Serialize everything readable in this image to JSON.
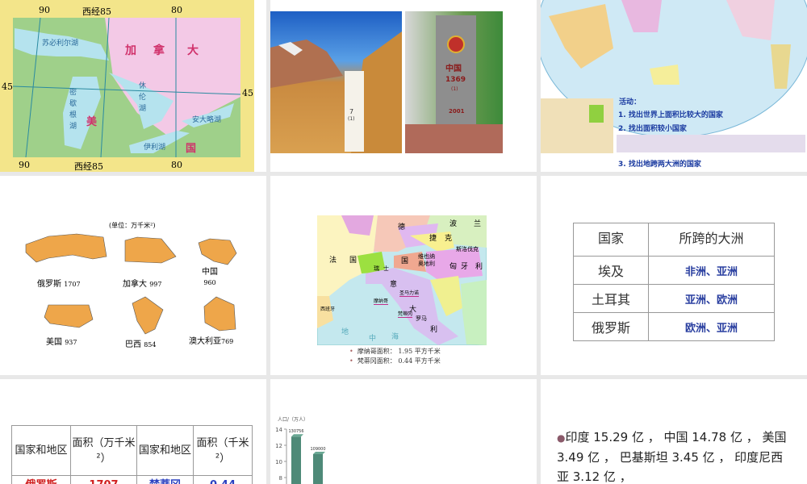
{
  "slides": [
    {
      "id": 1,
      "lon_labels": [
        "90",
        "西经85",
        "80"
      ],
      "lat_label": "45",
      "lakes": [
        "苏必利尔湖",
        "密歇根湖",
        "休伦湖",
        "伊利湖",
        "安大略湖"
      ],
      "countries": [
        "加",
        "拿",
        "大",
        "美",
        "国"
      ]
    },
    {
      "id": 2,
      "marker_left": {
        "number": "7",
        "sub": "(1)"
      },
      "marker_right": {
        "country": "中国",
        "number": "1369",
        "sub": "(1)",
        "year": "2001"
      }
    },
    {
      "id": 3,
      "activity_title": "活动：",
      "tasks": [
        "1. 找出世界上面积比较大的国家",
        "2. 找出面积较小国家",
        "3. 找出地跨两大洲的国家"
      ]
    },
    {
      "id": 4,
      "unit": "(单位：万千米²)",
      "countries": [
        {
          "name": "俄罗斯",
          "area": "1707"
        },
        {
          "name": "加拿大",
          "area": "997"
        },
        {
          "name": "中国",
          "area": "960"
        },
        {
          "name": "美国",
          "area": "937"
        },
        {
          "name": "巴西",
          "area": "854"
        },
        {
          "name": "澳大利亚",
          "area": "769"
        }
      ]
    },
    {
      "id": 5,
      "map_labels": [
        "德",
        "国",
        "波",
        "兰",
        "法",
        "国",
        "捷",
        "克",
        "斯洛伐克",
        "瑞",
        "士",
        "维也纳",
        "奥地利",
        "匈",
        "牙",
        "利",
        "意",
        "大",
        "利",
        "罗马",
        "摩纳哥",
        "梵蒂冈",
        "圣马力诺",
        "西班牙",
        "地",
        "中",
        "海"
      ],
      "notes": [
        {
          "label": "摩纳哥面积：",
          "value": "1.95 平方千米"
        },
        {
          "label": "梵蒂冈面积：",
          "value": "0.44 平方千米"
        }
      ]
    },
    {
      "id": 6,
      "headers": [
        "国家",
        "所跨的大洲"
      ],
      "rows": [
        [
          "埃及",
          "非洲、亚洲"
        ],
        [
          "土耳其",
          "亚洲、欧洲"
        ],
        [
          "俄罗斯",
          "欧洲、亚洲"
        ]
      ]
    },
    {
      "id": 7,
      "headers": [
        "国家和地区",
        "面积（万千米²）",
        "国家和地区",
        "面积（千米²）"
      ],
      "rows": [
        [
          "俄罗斯",
          "1707",
          "梵蒂冈",
          "0.44"
        ]
      ]
    },
    {
      "id": 8
    },
    {
      "id": 9,
      "bullet": "印度 15.29 亿 ， 中国 14.78 亿 ， 美国 3.49 亿 ， 巴基斯坦 3.45 亿 ， 印度尼西亚 3.12 亿 ，"
    }
  ],
  "chart_data": {
    "type": "bar",
    "ylabel": "人口/（万人）",
    "yticks": [
      "14",
      "12",
      "10",
      "8"
    ],
    "ylim": [
      7,
      14
    ],
    "values": [
      130756,
      109000
    ],
    "value_labels": [
      "130756",
      "109000"
    ]
  }
}
